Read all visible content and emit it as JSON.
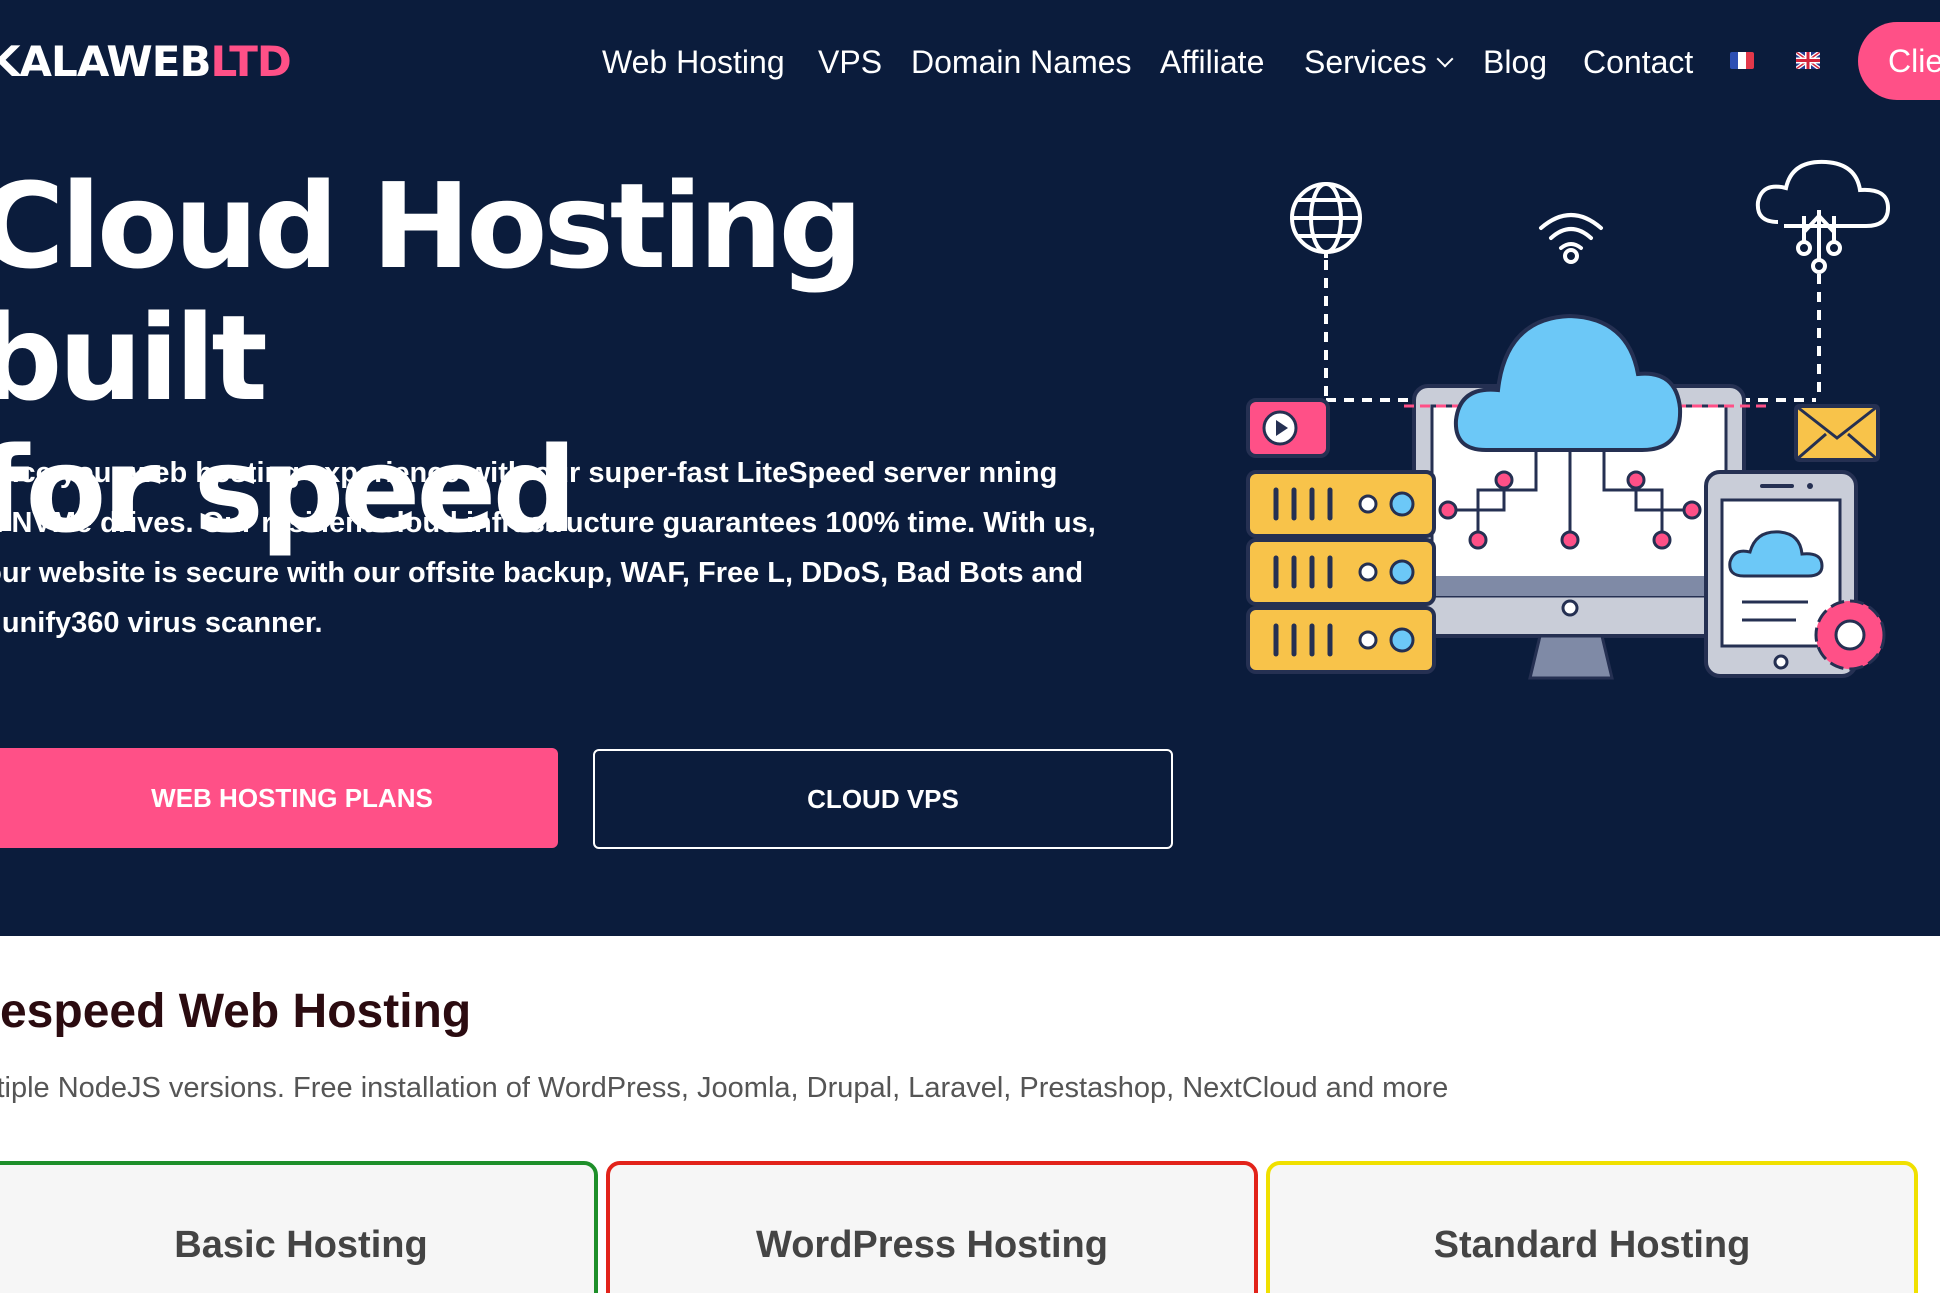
{
  "logo": {
    "part_white": "KALAWEB",
    "part_red": "LTD"
  },
  "nav": {
    "items": [
      {
        "label": "Web Hosting"
      },
      {
        "label": "VPS"
      },
      {
        "label": "Domain Names"
      },
      {
        "label": "Affiliate"
      },
      {
        "label": "Services"
      },
      {
        "label": "Blog"
      },
      {
        "label": "Contact"
      }
    ],
    "client_button": "Clie"
  },
  "hero": {
    "title_line1": "Cloud Hosting built",
    "title_line2": "for speed",
    "description": "hance your web hosting experience with our super-fast LiteSpeed server nning on NVMe drives. Our resilient cloud infrastructure guarantees 100% time. With us, your website is secure with our offsite backup, WAF, Free L, DDoS, Bad Bots and imunify360 virus scanner.",
    "primary_button": "WEB HOSTING PLANS",
    "secondary_button": "CLOUD VPS"
  },
  "section": {
    "title": "tespeed Web Hosting",
    "subtitle": "ltiple NodeJS versions. Free installation of WordPress, Joomla, Drupal, Laravel, Prestashop, NextCloud and more"
  },
  "plans": [
    {
      "name": "Basic Hosting",
      "border_color": "#1e8f2a"
    },
    {
      "name": "WordPress Hosting",
      "border_color": "#e2231a"
    },
    {
      "name": "Standard Hosting",
      "border_color": "#f0e000"
    }
  ],
  "colors": {
    "hero_background": "#0b1c3c",
    "accent": "#ff5087",
    "illustration_yellow": "#f8c34a",
    "illustration_blue": "#6cc8f7"
  }
}
